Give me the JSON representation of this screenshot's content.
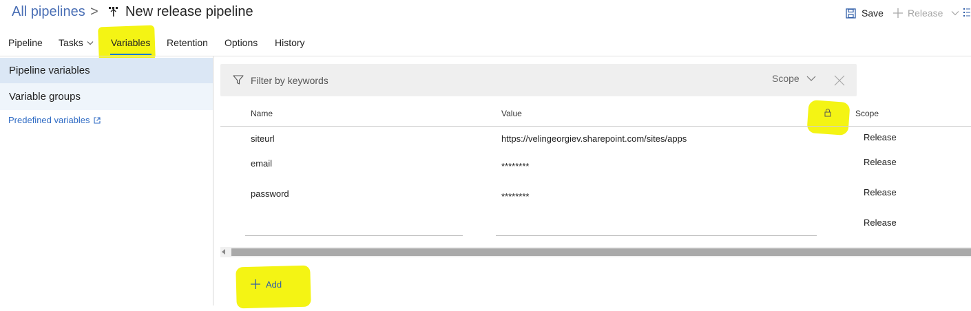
{
  "header": {
    "breadcrumb_root": "All pipelines",
    "breadcrumb_separator": ">",
    "title": "New release pipeline",
    "save_label": "Save",
    "release_label": "Release"
  },
  "tabs": [
    {
      "label": "Pipeline"
    },
    {
      "label": "Tasks"
    },
    {
      "label": "Variables",
      "active": true
    },
    {
      "label": "Retention"
    },
    {
      "label": "Options"
    },
    {
      "label": "History"
    }
  ],
  "sidebar": {
    "items": [
      {
        "label": "Pipeline variables",
        "selected": true
      },
      {
        "label": "Variable groups"
      }
    ],
    "predefined_link": "Predefined variables"
  },
  "filter": {
    "placeholder": "Filter by keywords",
    "scope_label": "Scope"
  },
  "table": {
    "columns": {
      "name": "Name",
      "value": "Value",
      "scope": "Scope"
    },
    "rows": [
      {
        "name": "siteurl",
        "value": "https://velingeorgiev.sharepoint.com/sites/apps",
        "scope": "Release"
      },
      {
        "name": "email",
        "value": "********",
        "scope": "Release"
      },
      {
        "name": "password",
        "value": "********",
        "scope": "Release"
      },
      {
        "name": "",
        "value": "",
        "scope": "Release"
      }
    ]
  },
  "add_label": "Add",
  "colors": {
    "accent": "#0078d4",
    "link": "#2f6bc4",
    "highlight": "#f3f300",
    "nav_selected": "#dbe7f5"
  },
  "icons": [
    "pipeline-icon",
    "save-icon",
    "plus-icon",
    "chevron-down-icon",
    "more-icon",
    "filter-icon",
    "close-icon",
    "lock-icon",
    "external-link-icon"
  ]
}
